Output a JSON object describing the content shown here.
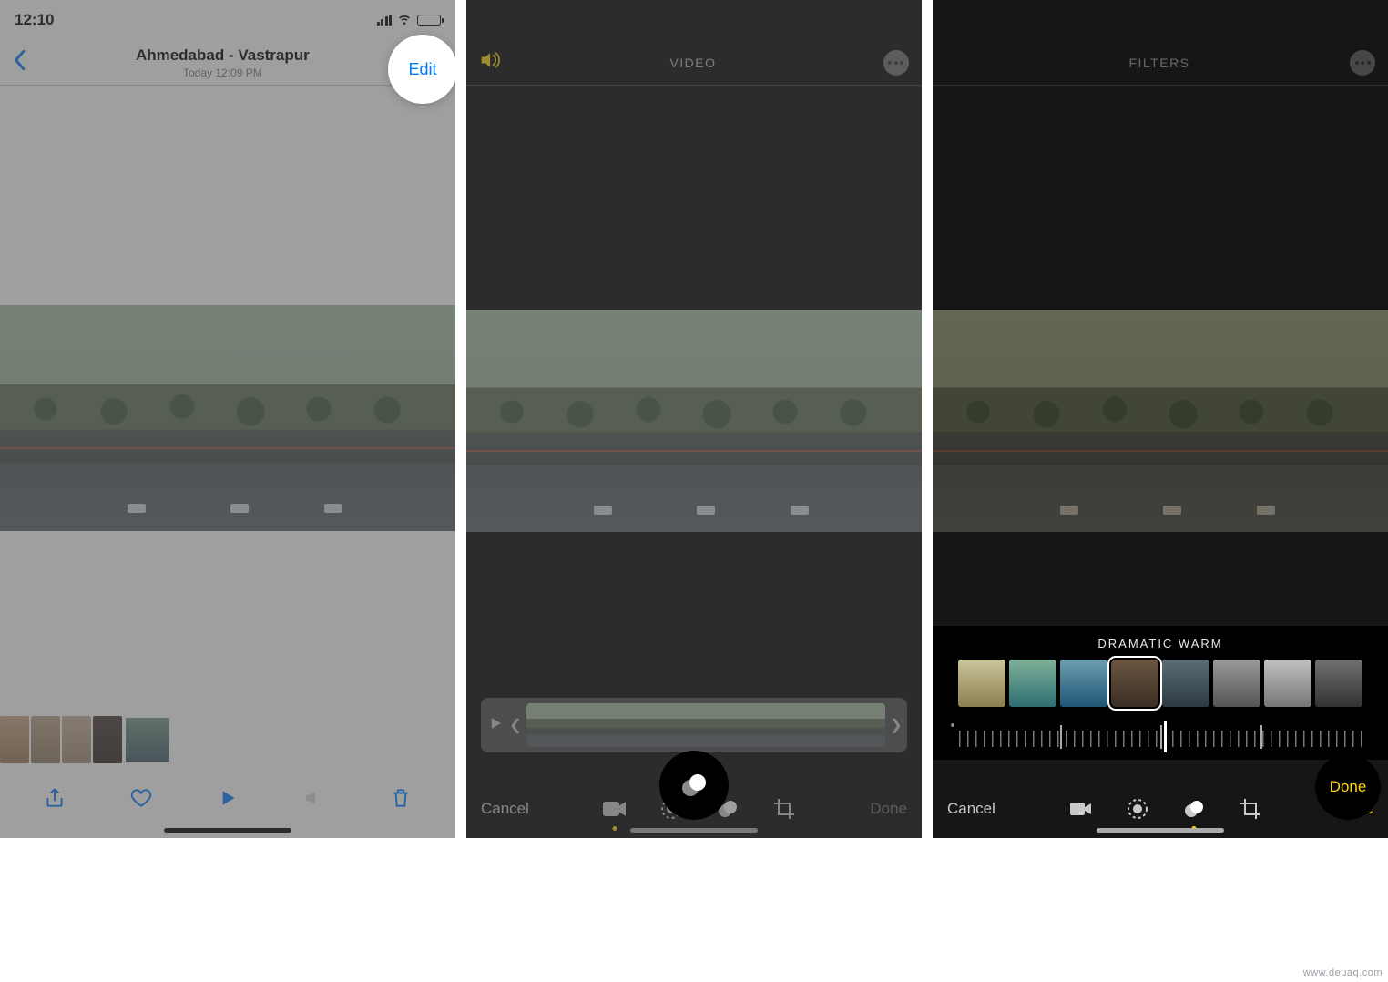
{
  "panel1": {
    "status_time": "12:10",
    "title": "Ahmedabad - Vastrapur",
    "subtitle": "Today  12:09 PM",
    "edit_label": "Edit"
  },
  "panel2": {
    "title": "VIDEO",
    "cancel_label": "Cancel",
    "done_label": "Done"
  },
  "panel3": {
    "title": "FILTERS",
    "filter_name": "DRAMATIC WARM",
    "cancel_label": "Cancel",
    "done_label": "Done"
  },
  "watermark": "www.deuaq.com"
}
